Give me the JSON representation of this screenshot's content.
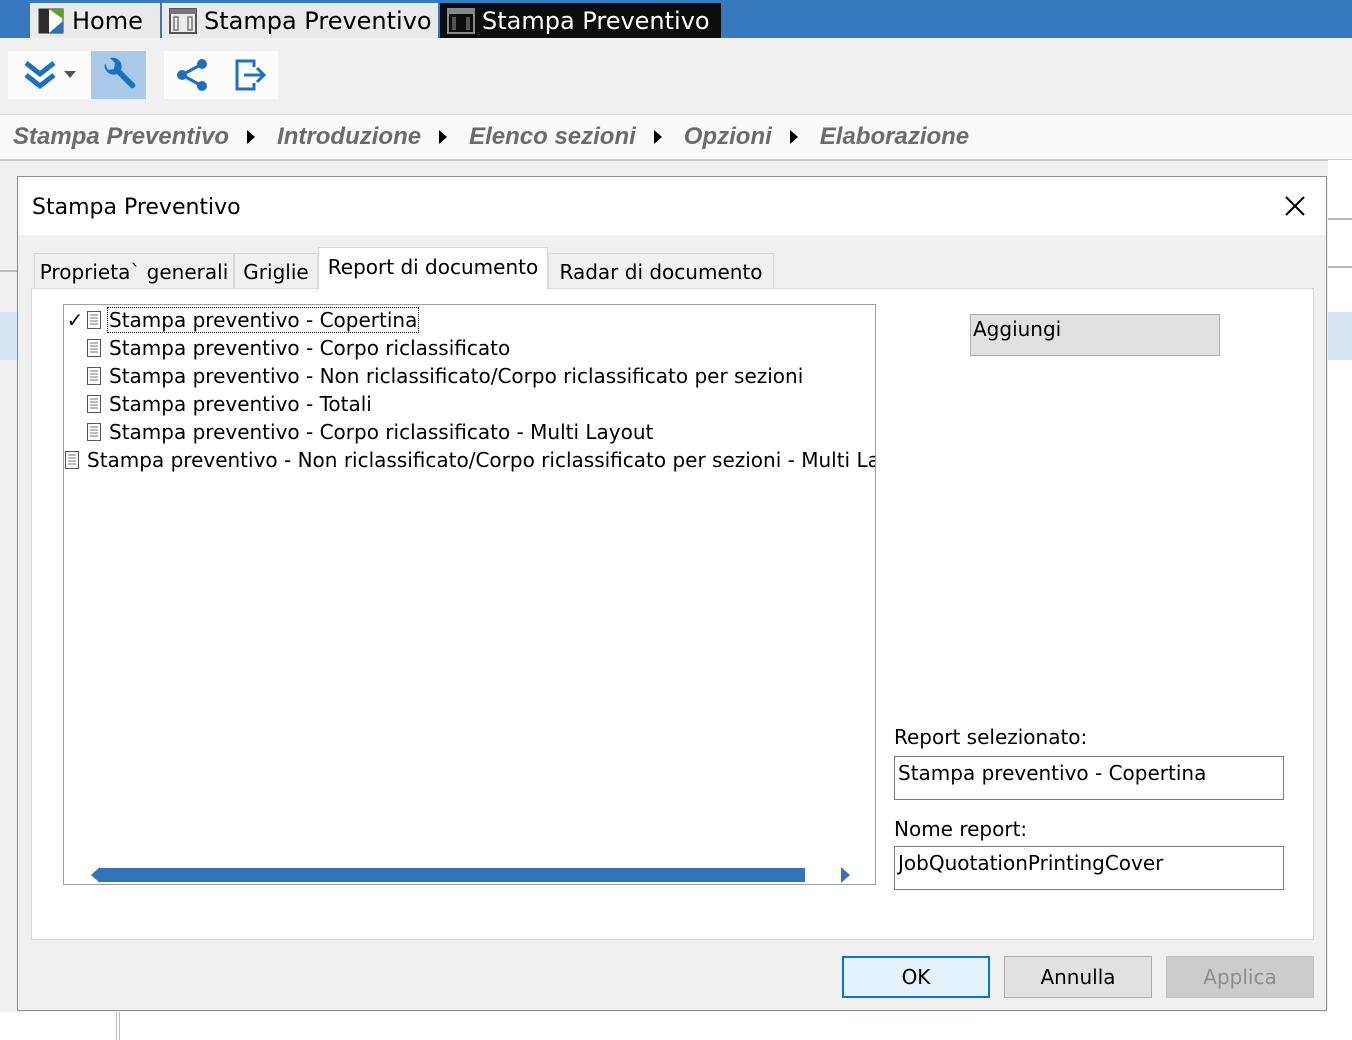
{
  "app_tabs": [
    {
      "label": "Home"
    },
    {
      "label": "Stampa Preventivo"
    },
    {
      "label": "Stampa Preventivo"
    }
  ],
  "breadcrumb": [
    "Stampa Preventivo",
    "Introduzione",
    "Elenco sezioni",
    "Opzioni",
    "Elaborazione"
  ],
  "dialog": {
    "title": "Stampa Preventivo",
    "tabs": [
      {
        "label": "Proprieta` generali"
      },
      {
        "label": "Griglie"
      },
      {
        "label": "Report di documento"
      },
      {
        "label": "Radar di documento"
      }
    ],
    "reports": [
      {
        "label": "Stampa preventivo - Copertina",
        "checked": true
      },
      {
        "label": "Stampa preventivo - Corpo riclassificato",
        "checked": false
      },
      {
        "label": "Stampa preventivo - Non riclassificato/Corpo riclassificato per sezioni",
        "checked": false
      },
      {
        "label": "Stampa preventivo - Totali",
        "checked": false
      },
      {
        "label": "Stampa preventivo - Corpo riclassificato - Multi Layout",
        "checked": false
      },
      {
        "label": "Stampa preventivo - Non riclassificato/Corpo riclassificato per sezioni - Multi Layout",
        "checked": false
      }
    ],
    "check_mark": "✓",
    "add_button": "Aggiungi",
    "selected_report_label": "Report selezionato:",
    "selected_report_value": "Stampa preventivo - Copertina",
    "report_name_label": "Nome report:",
    "report_name_value": "JobQuotationPrintingCover",
    "ok_label": "OK",
    "cancel_label": "Annulla",
    "apply_label": "Applica"
  },
  "colors": {
    "tabstrip": "#3779bf",
    "active_tab": "#0d0d0d",
    "toolbar_icon": "#1f6fbf",
    "scrollbar": "#3472b8"
  }
}
